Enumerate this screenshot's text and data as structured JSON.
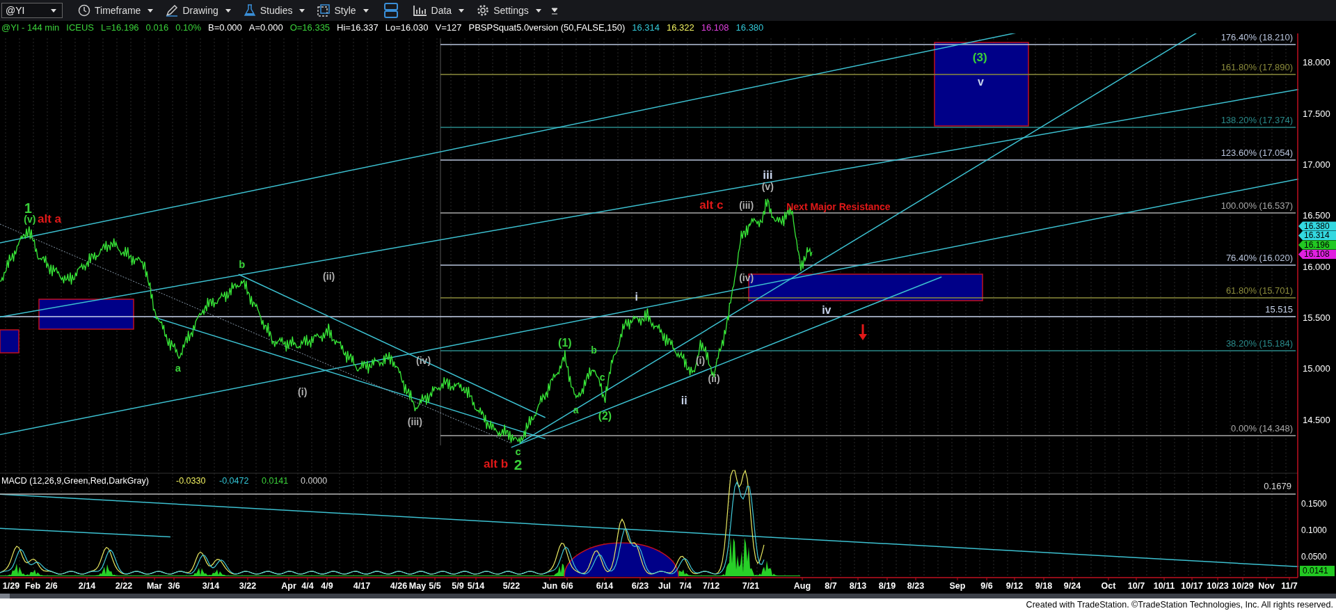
{
  "toolbar": {
    "symbol": "@YI",
    "menus": [
      {
        "label": "Timeframe"
      },
      {
        "label": "Drawing"
      },
      {
        "label": "Studies"
      },
      {
        "label": "Style"
      },
      {
        "label": "Data"
      },
      {
        "label": "Settings"
      }
    ]
  },
  "quote_line": [
    {
      "text": "@YI - 144 min",
      "color": "#3ad13a"
    },
    {
      "text": "ICEUS",
      "color": "#3ad13a"
    },
    {
      "text": "L=16.196",
      "color": "#3ad13a"
    },
    {
      "text": "0.016",
      "color": "#3ad13a"
    },
    {
      "text": "0.10%",
      "color": "#3ad13a"
    },
    {
      "text": "B=0.000",
      "color": "#ffffff"
    },
    {
      "text": "A=0.000",
      "color": "#ffffff"
    },
    {
      "text": "O=16.335",
      "color": "#3ad13a"
    },
    {
      "text": "Hi=16.337",
      "color": "#ffffff"
    },
    {
      "text": "Lo=16.030",
      "color": "#ffffff"
    },
    {
      "text": "V=127",
      "color": "#ffffff"
    },
    {
      "text": "PBSPSquat5.0version (50,FALSE,150)",
      "color": "#ffffff"
    },
    {
      "text": "16.314",
      "color": "#33c8d8"
    },
    {
      "text": "16.322",
      "color": "#f0f060"
    },
    {
      "text": "16.108",
      "color": "#e040e0"
    },
    {
      "text": "16.380",
      "color": "#33c8d8"
    }
  ],
  "fib_levels": [
    {
      "label": "176.40% (18.210)",
      "color": "#b8c4dc"
    },
    {
      "label": "161.80% (17.890)",
      "color": "#8c8c3c"
    },
    {
      "label": "138.20% (17.374)",
      "color": "#2a8a8a"
    },
    {
      "label": "123.60% (17.054)",
      "color": "#b8c4dc"
    },
    {
      "label": "100.00% (16.537)",
      "color": "#a8a8a8"
    },
    {
      "label": "76.40% (16.020)",
      "color": "#b8c4dc"
    },
    {
      "label": "61.80% (15.701)",
      "color": "#8c8c3c"
    },
    {
      "label": "15.515",
      "color": "#c8d4ec"
    },
    {
      "label": "38.20% (15.184)",
      "color": "#2a8a8a"
    },
    {
      "label": "0.00% (14.348)",
      "color": "#a8a8a8"
    }
  ],
  "wave_labels": [
    {
      "text": "1",
      "color": "#3ad13a"
    },
    {
      "text": "(v)",
      "color": "#3ad13a"
    },
    {
      "text": "alt a",
      "color": "#e01818"
    },
    {
      "text": "a",
      "color": "#3ad13a"
    },
    {
      "text": "b",
      "color": "#3ad13a"
    },
    {
      "text": "(i)",
      "color": "#b0b0b0"
    },
    {
      "text": "(ii)",
      "color": "#b0b0b0"
    },
    {
      "text": "(iii)",
      "color": "#b0b0b0"
    },
    {
      "text": "(iv)",
      "color": "#b0b0b0"
    },
    {
      "text": "alt b",
      "color": "#e01818"
    },
    {
      "text": "c",
      "color": "#3ad13a"
    },
    {
      "text": "2",
      "color": "#3ad13a"
    },
    {
      "text": "(1)",
      "color": "#3ad13a"
    },
    {
      "text": "b",
      "color": "#3ad13a"
    },
    {
      "text": "a",
      "color": "#3ad13a"
    },
    {
      "text": "c",
      "color": "#3ad13a"
    },
    {
      "text": "(2)",
      "color": "#3ad13a"
    },
    {
      "text": "i",
      "color": "#c8d4ec"
    },
    {
      "text": "ii",
      "color": "#c8d4ec"
    },
    {
      "text": "(i)",
      "color": "#b0b0b0"
    },
    {
      "text": "(ii)",
      "color": "#b0b0b0"
    },
    {
      "text": "alt c",
      "color": "#e01818"
    },
    {
      "text": "(iii)",
      "color": "#b0b0b0"
    },
    {
      "text": "(iv)",
      "color": "#b0b0b0"
    },
    {
      "text": "iii",
      "color": "#c8d4ec"
    },
    {
      "text": "(v)",
      "color": "#b0b0b0"
    },
    {
      "text": "Next Major Resistance",
      "color": "#e01818"
    },
    {
      "text": "iv",
      "color": "#c8d4ec"
    },
    {
      "text": "(3)",
      "color": "#3ad13a"
    },
    {
      "text": "v",
      "color": "#c8d4ec"
    }
  ],
  "price_axis": [
    "18.000",
    "17.500",
    "17.000",
    "16.500",
    "16.000",
    "15.500",
    "15.000",
    "14.500"
  ],
  "price_tags": [
    {
      "text": "16.380",
      "color": "#33d8e0"
    },
    {
      "text": "16.314",
      "color": "#33d8e0"
    },
    {
      "text": "16.196",
      "color": "#22c822"
    },
    {
      "text": "16.108",
      "color": "#e020e0"
    }
  ],
  "macd": {
    "legend": [
      {
        "text": "MACD (12,26,9,Green,Red,DarkGray)",
        "color": "#ffffff"
      },
      {
        "text": "-0.0330",
        "color": "#f0f060"
      },
      {
        "text": "-0.0472",
        "color": "#33c8d8"
      },
      {
        "text": "0.0141",
        "color": "#3ad13a"
      },
      {
        "text": "0.0000",
        "color": "#d0d0d0"
      }
    ],
    "level_label": "0.1679",
    "axis": [
      "0.1500",
      "0.1000",
      "0.0500"
    ],
    "current_tag": "0.0141"
  },
  "date_axis": [
    "1/29",
    "Feb",
    "2/6",
    "2/14",
    "2/22",
    "Mar",
    "3/6",
    "3/14",
    "3/22",
    "Apr",
    "4/4",
    "4/9",
    "4/17",
    "4/26",
    "May",
    "5/5",
    "5/9",
    "5/14",
    "5/22",
    "Jun",
    "6/6",
    "6/14",
    "6/23",
    "Jul",
    "7/4",
    "7/12",
    "7/21",
    "Aug",
    "8/7",
    "8/13",
    "8/19",
    "8/23",
    "Sep",
    "9/6",
    "9/12",
    "9/18",
    "9/24",
    "Oct",
    "10/7",
    "10/11",
    "10/17",
    "10/23",
    "10/29",
    "Nov",
    "11/7"
  ],
  "footer": "Created with TradeStation. ©TradeStation Technologies, Inc. All rights reserved."
}
